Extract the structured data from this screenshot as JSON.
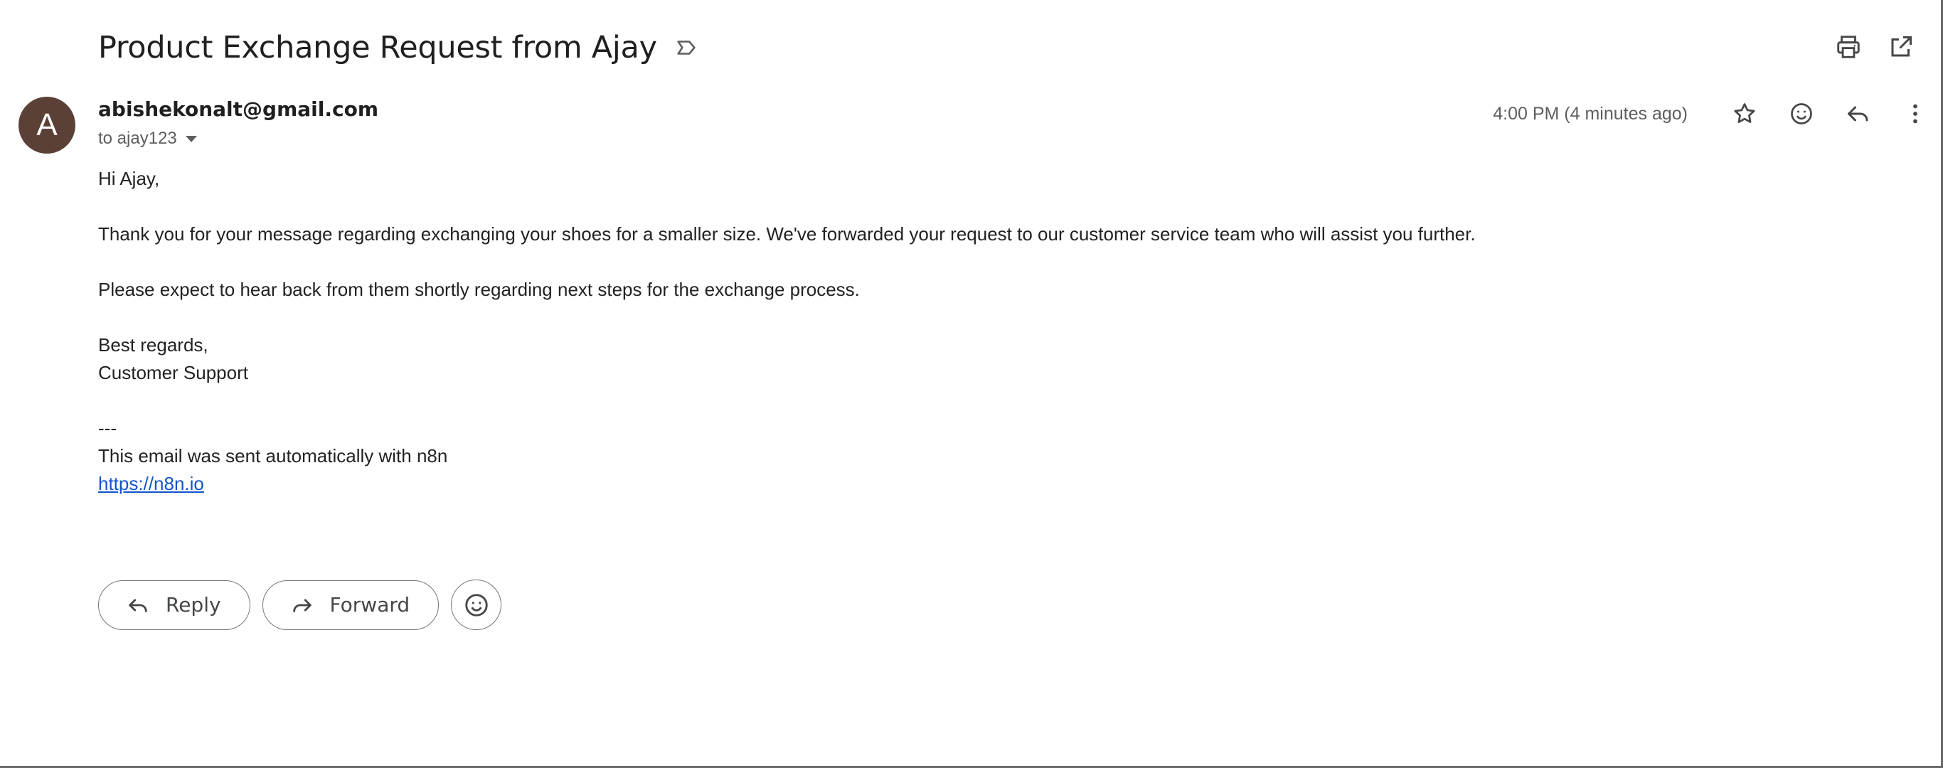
{
  "email": {
    "subject": "Product Exchange Request from Ajay",
    "sender": "abishekonalt@gmail.com",
    "avatar_letter": "A",
    "recipient": "to ajay123",
    "timestamp": "4:00 PM (4 minutes ago)",
    "body": {
      "greeting": "Hi Ajay,",
      "paragraph1": "Thank you for your message regarding exchanging your shoes for a smaller size. We've forwarded your request to our customer service team who will assist you further.",
      "paragraph2": "Please expect to hear back from them shortly regarding next steps for the exchange process.",
      "closing": "Best regards,",
      "signature": "Customer Support",
      "separator": "---",
      "footer": "This email was sent automatically with n8n",
      "link": "https://n8n.io"
    }
  },
  "actions": {
    "reply_label": "Reply",
    "forward_label": "Forward"
  },
  "icons": {
    "label": "label-icon",
    "print": "print-icon",
    "open_new_window": "open-in-new-icon",
    "star": "star-icon",
    "emoji": "emoji-icon",
    "reply": "reply-icon",
    "more": "more-vert-icon",
    "forward": "forward-icon"
  },
  "colors": {
    "avatar_bg": "#5b4037",
    "link": "#1155cc",
    "text": "#1f1f1f",
    "muted": "#5e5e5e"
  }
}
